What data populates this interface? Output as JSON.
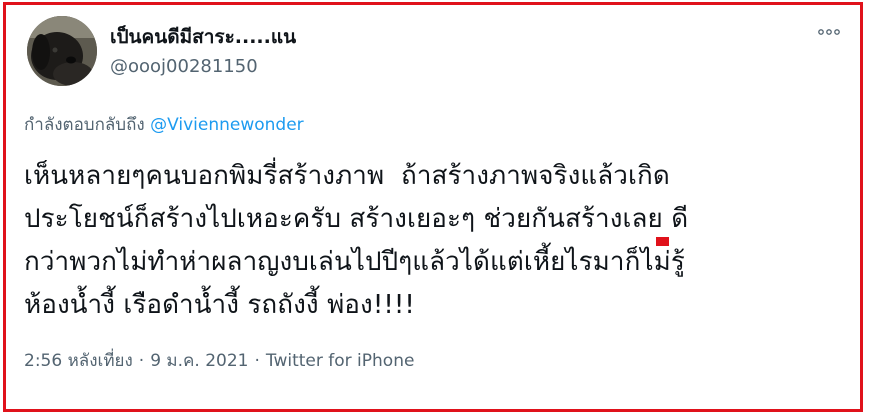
{
  "tweet": {
    "display_name": "เป็นคนดีมีสาระ.....แน",
    "handle": "@oooj00281150",
    "reply_prefix": "กำลังตอบกลับถึง",
    "reply_to": "@Viviennewonder",
    "text": "เห็นหลายๆคนบอกพิมรี่สร้างภาพ  ถ้าสร้างภาพจริงแล้วเกิด\nประโยชน์ก็สร้างไปเหอะครับ สร้างเยอะๆ ช่วยกันสร้างเลย ดี\nกว่าพวกไม่ทำห่าผลาญงบเล่นไปปีๆแล้วได้แต่เหี้ยไรมาก็ไม่รู้\nห้องน้ำงี้ เรือดำน้ำงี้ รถถังงี้ พ่อง!!!!",
    "time": "2:56 หลังเที่ยง",
    "date": "9 ม.ค. 2021",
    "source": "Twitter for iPhone",
    "separator": "·"
  },
  "icons": {
    "more": "more-dots-icon",
    "avatar": "dog-avatar"
  },
  "colors": {
    "frame": "#e0121b",
    "link": "#1d9bf0",
    "secondary": "#536471",
    "text": "#0f1419"
  }
}
